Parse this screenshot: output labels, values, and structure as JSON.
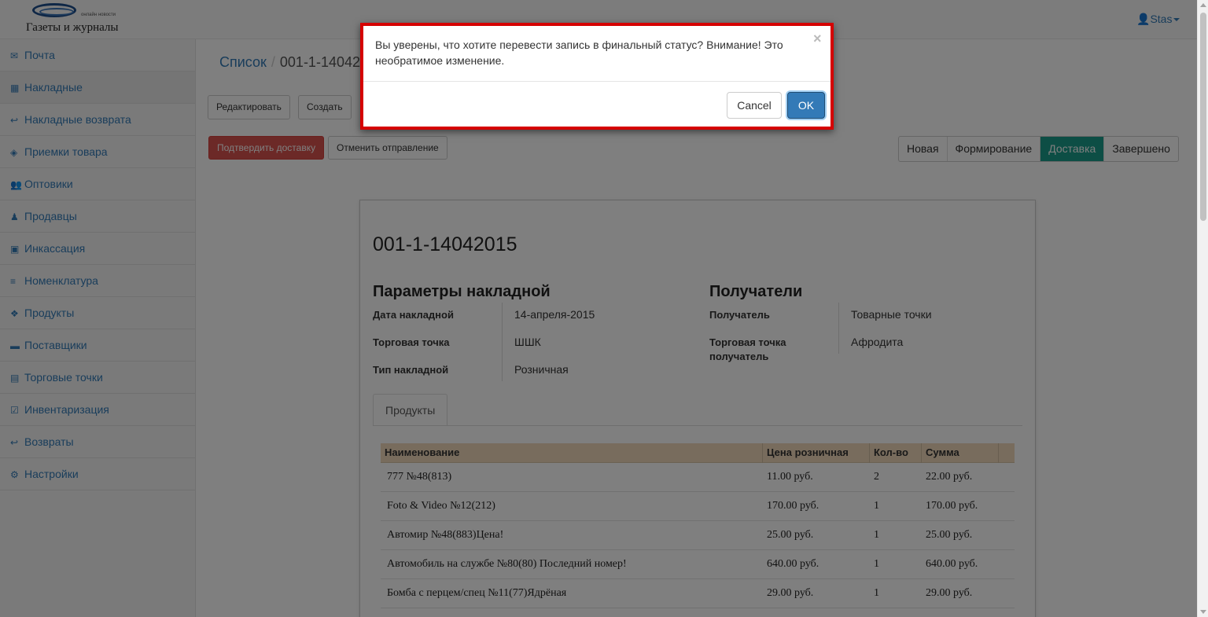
{
  "header": {
    "brand_small": "онлайн новости",
    "brand_text": "Газеты и журналы",
    "user_name": "Stas"
  },
  "sidebar": {
    "items": [
      {
        "label": "Почта",
        "icon": "envelope-icon",
        "glyph": "✉"
      },
      {
        "label": "Накладные",
        "icon": "table-icon",
        "glyph": "▦"
      },
      {
        "label": "Накладные возврата",
        "icon": "reply-icon",
        "glyph": "↩"
      },
      {
        "label": "Приемки товара",
        "icon": "cube-icon",
        "glyph": "◈"
      },
      {
        "label": "Оптовики",
        "icon": "users-icon",
        "glyph": "👥"
      },
      {
        "label": "Продавцы",
        "icon": "male-icon",
        "glyph": "♟"
      },
      {
        "label": "Инкассация",
        "icon": "money-icon",
        "glyph": "▣"
      },
      {
        "label": "Номенклатура",
        "icon": "list-icon",
        "glyph": "≡"
      },
      {
        "label": "Продукты",
        "icon": "cubes-icon",
        "glyph": "❖"
      },
      {
        "label": "Поставщики",
        "icon": "truck-icon",
        "glyph": "▬"
      },
      {
        "label": "Торговые точки",
        "icon": "shop-icon",
        "glyph": "▤"
      },
      {
        "label": "Инвентаризация",
        "icon": "check-square-icon",
        "glyph": "☑"
      },
      {
        "label": "Возвраты",
        "icon": "reply-all-icon",
        "glyph": "↩"
      },
      {
        "label": "Настройки",
        "icon": "cogs-icon",
        "glyph": "⚙"
      }
    ]
  },
  "breadcrumb": {
    "list": "Список",
    "separator": "/",
    "current": "001-1-14042015"
  },
  "toolbar": {
    "edit": "Редактировать",
    "create": "Создать",
    "confirm_delivery": "Подтвердить доставку",
    "cancel_shipment": "Отменить отправление"
  },
  "statuses": [
    "Новая",
    "Формирование",
    "Доставка",
    "Завершено"
  ],
  "active_status": "Доставка",
  "document": {
    "title": "001-1-14042015",
    "params_heading": "Параметры накладной",
    "params": [
      {
        "label": "Дата накладной",
        "value": "14-апреля-2015"
      },
      {
        "label": "Торговая точка",
        "value": "ШШК"
      },
      {
        "label": "Тип накладной",
        "value": "Розничная"
      }
    ],
    "recipients_heading": "Получатели",
    "recipients": [
      {
        "label": "Получатель",
        "value": "Товарные точки"
      },
      {
        "label": "Торговая точка получатель",
        "value": "Афродита"
      }
    ],
    "tab_products": "Продукты"
  },
  "products_table": {
    "headers": [
      "Наименование",
      "Цена розничная",
      "Кол-во",
      "Сумма"
    ],
    "rows": [
      [
        "777 №48(813)",
        "11.00 руб.",
        "2",
        "22.00 руб."
      ],
      [
        "Foto & Video №12(212)",
        "170.00 руб.",
        "1",
        "170.00 руб."
      ],
      [
        "Автомир №48(883)Цена!",
        "25.00 руб.",
        "1",
        "25.00 руб."
      ],
      [
        "Автомобиль на службе №80(80) Последний номер!",
        "640.00 руб.",
        "1",
        "640.00 руб."
      ],
      [
        "Бомба с перцем/спец №11(77)Ядрёная",
        "29.00 руб.",
        "1",
        "29.00 руб."
      ]
    ]
  },
  "modal": {
    "message": "Вы уверены, что хотите перевести запись в финальный статус? Внимание! Это необратимое изменение.",
    "close": "×",
    "cancel": "Cancel",
    "ok": "OK"
  },
  "colors": {
    "link": "#337ab7",
    "danger": "#d9534f",
    "active_status": "#1a9c8a",
    "table_header": "#f1d9bb",
    "modal_highlight": "#d50000"
  }
}
